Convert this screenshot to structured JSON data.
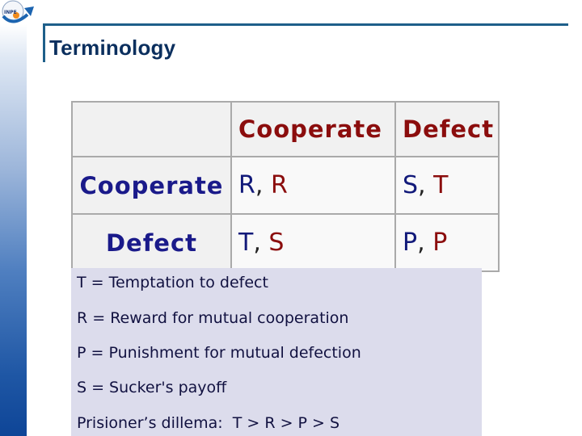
{
  "slide": {
    "title": "Terminology",
    "logo_icon": "inpe-logo-icon",
    "logo_text": "INPE"
  },
  "payoff_matrix": {
    "column_headers": [
      "",
      "Cooperate",
      "Defect"
    ],
    "rows": [
      {
        "label": "Cooperate",
        "cells": [
          {
            "player1": "R",
            "player2": "R"
          },
          {
            "player1": "S",
            "player2": "T"
          }
        ]
      },
      {
        "label": "Defect",
        "cells": [
          {
            "player1": "T",
            "player2": "S"
          },
          {
            "player1": "P",
            "player2": "P"
          }
        ]
      }
    ],
    "separator": ","
  },
  "definitions": [
    "T = Temptation to defect",
    "R = Reward for mutual cooperation",
    "P = Punishment for mutual defection",
    "S = Sucker's payoff",
    "Prisioner’s dillema:  T > R > P > S"
  ],
  "colors": {
    "row_player": "#121a7a",
    "column_player": "#8b0d0d",
    "title": "#0b2f5e",
    "frame": "#1e5f8a",
    "legend_background": "#dcdcec"
  }
}
